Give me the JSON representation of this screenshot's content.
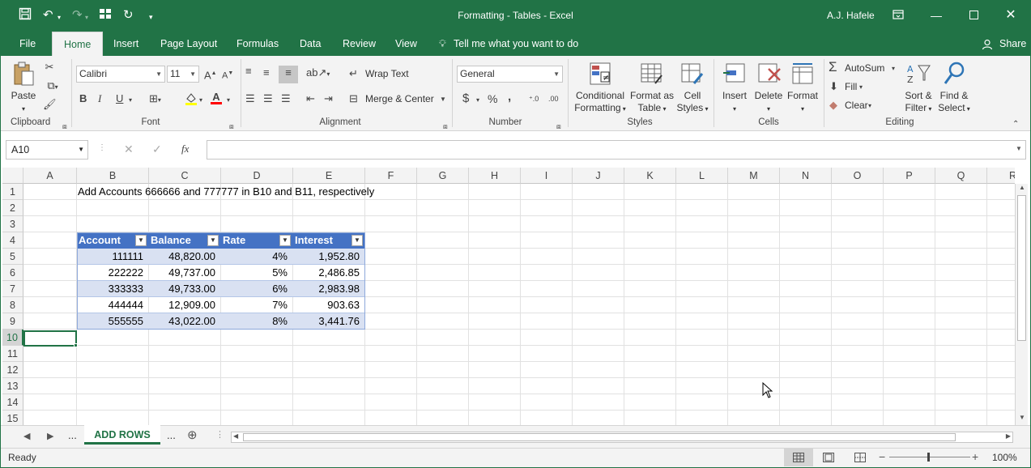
{
  "window": {
    "title": "Formatting - Tables  -  Excel",
    "user": "A.J. Hafele"
  },
  "tabs": [
    "File",
    "Home",
    "Insert",
    "Page Layout",
    "Formulas",
    "Data",
    "Review",
    "View"
  ],
  "tell_me": "Tell me what you want to do",
  "share": "Share",
  "ribbon": {
    "clipboard": {
      "paste": "Paste",
      "label": "Clipboard"
    },
    "font": {
      "name": "Calibri",
      "size": "11",
      "label": "Font",
      "bold": "B",
      "italic": "I",
      "underline": "U"
    },
    "alignment": {
      "wrap": "Wrap Text",
      "merge": "Merge & Center",
      "label": "Alignment"
    },
    "number": {
      "format": "General",
      "label": "Number",
      "currency": "$",
      "percent": "%",
      "comma": ","
    },
    "styles": {
      "conditional_1": "Conditional",
      "conditional_2": "Formatting",
      "table_1": "Format as",
      "table_2": "Table",
      "cell_1": "Cell",
      "cell_2": "Styles",
      "label": "Styles"
    },
    "cells": {
      "insert": "Insert",
      "delete": "Delete",
      "format": "Format",
      "label": "Cells"
    },
    "editing": {
      "autosum": "AutoSum",
      "fill": "Fill",
      "clear": "Clear",
      "sort_1": "Sort &",
      "sort_2": "Filter",
      "find_1": "Find &",
      "find_2": "Select",
      "label": "Editing"
    }
  },
  "formula_bar": {
    "name_box": "A10",
    "fx": "fx",
    "content": ""
  },
  "columns": [
    "A",
    "B",
    "C",
    "D",
    "E",
    "F",
    "G",
    "H",
    "I",
    "J",
    "K",
    "L",
    "M",
    "N",
    "O",
    "P",
    "Q",
    "R"
  ],
  "rows": [
    "1",
    "2",
    "3",
    "4",
    "5",
    "6",
    "7",
    "8",
    "9",
    "10",
    "11",
    "12",
    "13",
    "14",
    "15"
  ],
  "sheet": {
    "instruction": "Add Accounts 666666 and 777777 in B10 and B11, respectively",
    "table": {
      "headers": [
        "Account",
        "Balance",
        "Rate",
        "Interest"
      ],
      "rows": [
        [
          "111111",
          "48,820.00",
          "4%",
          "1,952.80"
        ],
        [
          "222222",
          "49,737.00",
          "5%",
          "2,486.85"
        ],
        [
          "333333",
          "49,733.00",
          "6%",
          "2,983.98"
        ],
        [
          "444444",
          "12,909.00",
          "7%",
          "903.63"
        ],
        [
          "555555",
          "43,022.00",
          "8%",
          "3,441.76"
        ]
      ]
    },
    "active_cell": "A10"
  },
  "sheet_tabs": {
    "active": "ADD ROWS",
    "ellipsis": "..."
  },
  "status": {
    "ready": "Ready",
    "zoom": "100%"
  },
  "colors": {
    "excel_green": "#217346",
    "table_header": "#4472c4",
    "table_band": "#d9e1f2"
  }
}
